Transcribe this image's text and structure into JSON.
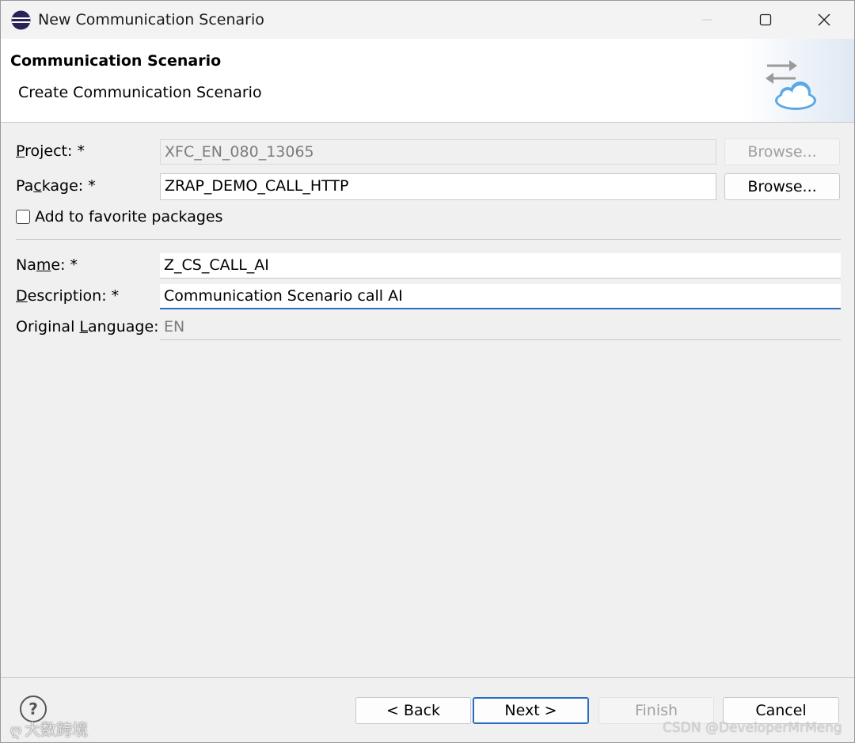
{
  "window": {
    "title": "New Communication Scenario",
    "controls": {
      "minimize": "minimize-icon",
      "maximize": "maximize-icon",
      "close": "close-icon"
    }
  },
  "banner": {
    "title": "Communication Scenario",
    "subtitle": "Create Communication Scenario",
    "icon": "arrows-cloud-icon"
  },
  "form": {
    "project": {
      "label_pre": "",
      "label_key": "P",
      "label_post": "roject: *",
      "value": "XFC_EN_080_13065",
      "browse": "Browse..."
    },
    "package": {
      "label_pre": "Pa",
      "label_key": "c",
      "label_post": "kage: *",
      "value": "ZRAP_DEMO_CALL_HTTP",
      "browse": "Browse..."
    },
    "favorite": {
      "label": "Add to favorite packages",
      "checked": false
    },
    "name": {
      "label_pre": "Na",
      "label_key": "m",
      "label_post": "e: *",
      "value": "Z_CS_CALL_AI"
    },
    "description": {
      "label_pre": "",
      "label_key": "D",
      "label_post": "escription: *",
      "value": "Communication Scenario call AI"
    },
    "language": {
      "label_pre": "Original ",
      "label_key": "L",
      "label_post": "anguage:",
      "value": "EN"
    }
  },
  "footer": {
    "help": "?",
    "back": "< Back",
    "next": "Next >",
    "finish": "Finish",
    "cancel": "Cancel"
  },
  "watermarks": {
    "left": "大数跨境",
    "right": "CSDN @DeveloperMrMeng"
  },
  "colors": {
    "accent": "#2a6cc4",
    "window_bg": "#f0f0f0",
    "disabled_text": "#7c7c7c"
  }
}
